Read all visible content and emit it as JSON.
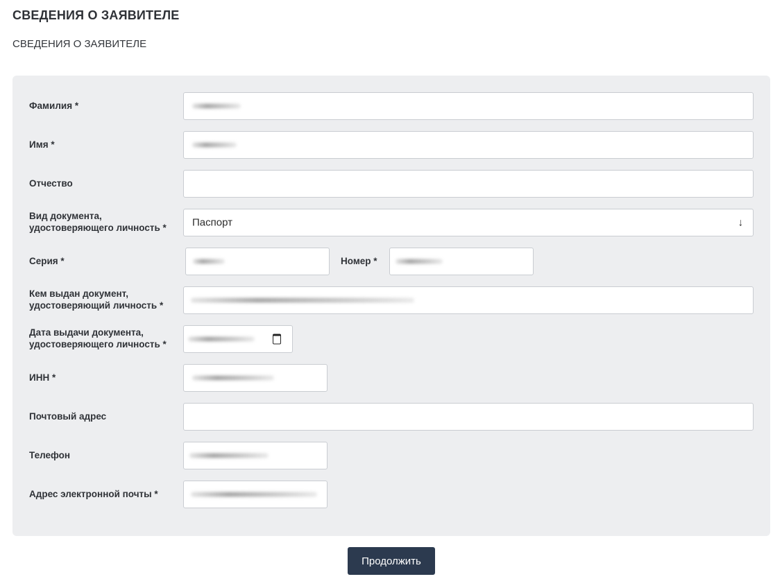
{
  "header": {
    "title": "СВЕДЕНИЯ О ЗАЯВИТЕЛЕ",
    "subtitle": "СВЕДЕНИЯ О ЗАЯВИТЕЛЕ"
  },
  "form": {
    "last_name": {
      "label": "Фамилия *",
      "value_redacted": true
    },
    "first_name": {
      "label": "Имя *",
      "value_redacted": true
    },
    "patronymic": {
      "label": "Отчество",
      "value": ""
    },
    "doc_type": {
      "label_line1": "Вид документа,",
      "label_line2": "удостоверяющего личность *",
      "value": "Паспорт",
      "arrow_icon": "arrow-down-icon"
    },
    "series": {
      "label": "Серия *",
      "value_redacted": true
    },
    "number": {
      "label": "Номер *",
      "value_redacted": true
    },
    "issued_by": {
      "label_line1": "Кем выдан документ,",
      "label_line2": "удостоверяющий личность *",
      "value_redacted": true
    },
    "issue_date": {
      "label_line1": "Дата выдачи документа,",
      "label_line2": "удостоверяющего личность *",
      "value_redacted": true,
      "icon": "calendar-icon"
    },
    "inn": {
      "label": "ИНН *",
      "value_redacted": true
    },
    "postal_address": {
      "label": "Почтовый адрес",
      "value": ""
    },
    "phone": {
      "label": "Телефон",
      "value_redacted": true
    },
    "email": {
      "label": "Адрес электронной почты *",
      "value_redacted": true
    }
  },
  "actions": {
    "continue_label": "Продолжить"
  },
  "colors": {
    "panel_bg": "#edeef0",
    "button_bg": "#2c3a4f",
    "field_border": "#c9ccd1"
  }
}
